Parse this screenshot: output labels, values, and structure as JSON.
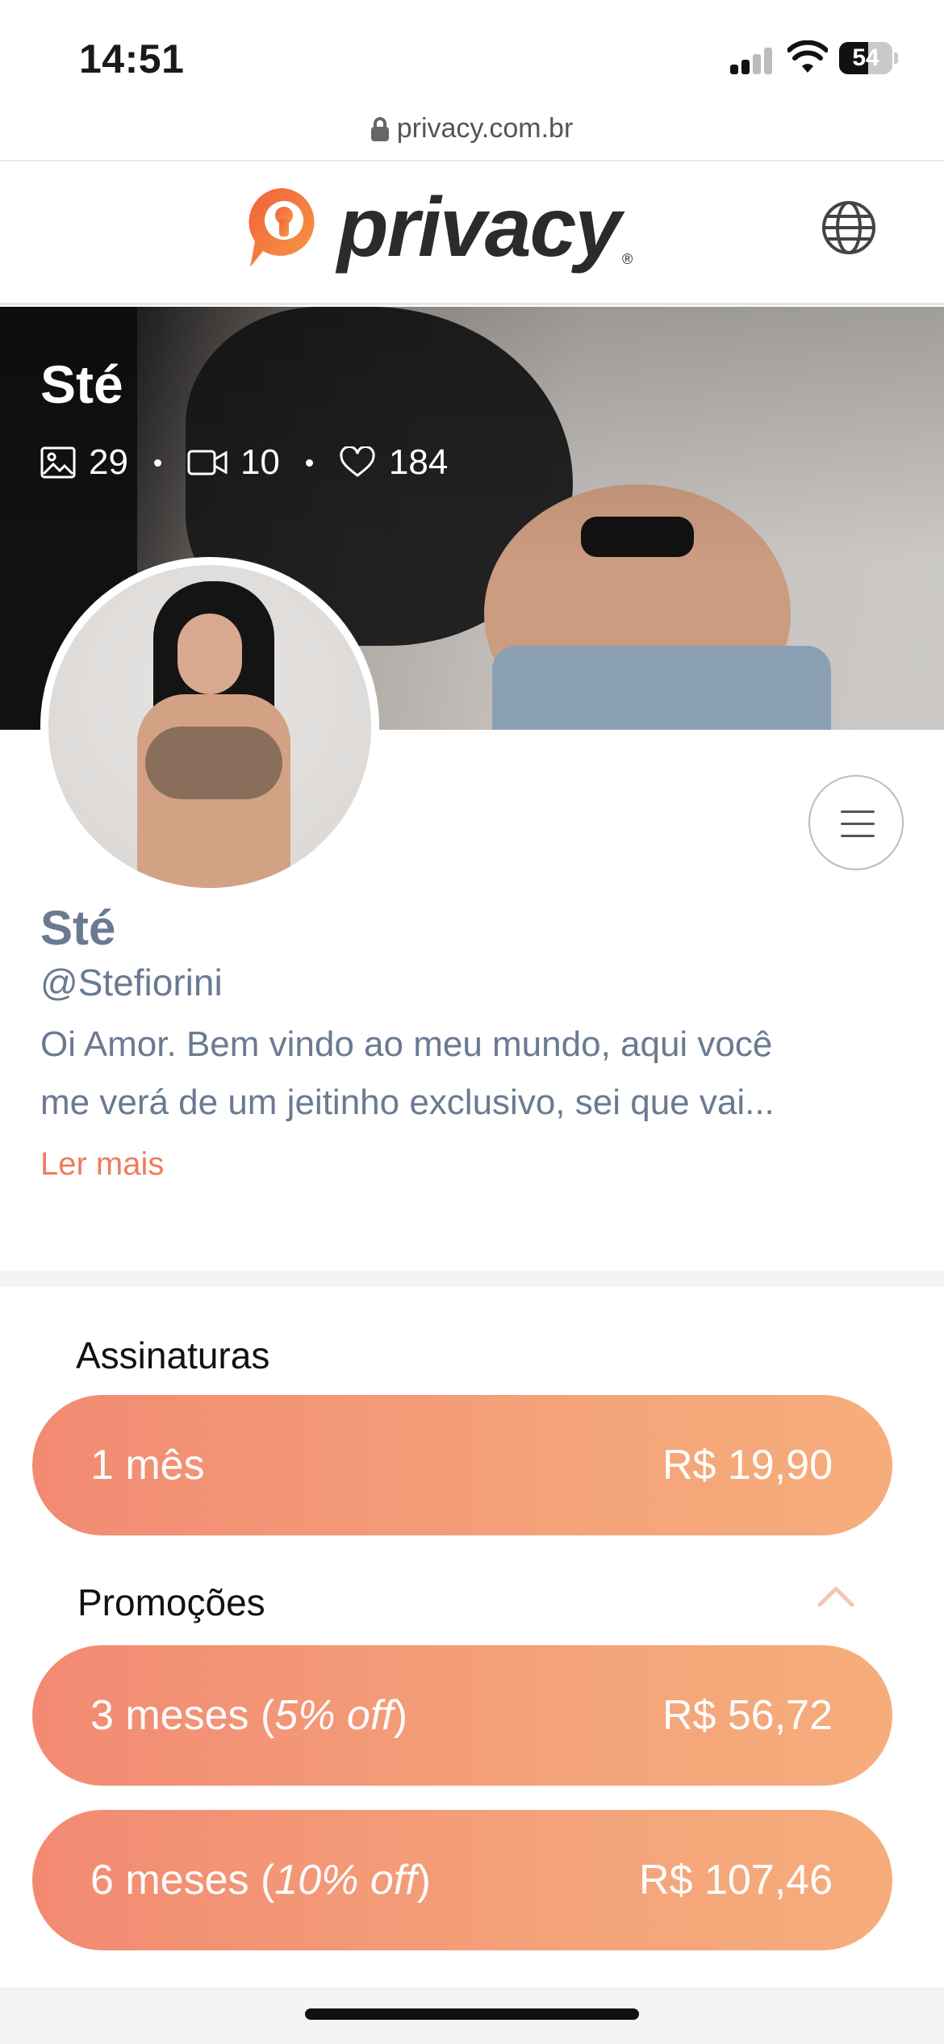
{
  "status_bar": {
    "time": "14:51",
    "battery": "54",
    "battery_level": 0.54
  },
  "browser": {
    "url": "privacy.com.br"
  },
  "header": {
    "brand": "privacy",
    "colors": {
      "brand_orange": "#f26b3a",
      "brand_dark": "#2b2b2b"
    }
  },
  "cover": {
    "name": "Sté",
    "stats": {
      "photos": "29",
      "videos": "10",
      "likes": "184"
    }
  },
  "profile": {
    "name": "Sté",
    "handle": "@Stefiorini",
    "bio_line1": "Oi Amor. Bem vindo ao meu mundo, aqui você",
    "bio_line2": "me verá de um jeitinho exclusivo, sei que vai...",
    "read_more": "Ler mais"
  },
  "subscriptions": {
    "title": "Assinaturas",
    "plans": [
      {
        "label": "1 mês",
        "price": "R$ 19,90"
      }
    ]
  },
  "promotions": {
    "title": "Promoções",
    "plans": [
      {
        "label_prefix": "3 meses (",
        "discount": "5% off",
        "label_suffix": ")",
        "price": "R$ 56,72"
      },
      {
        "label_prefix": "6 meses (",
        "discount": "10% off",
        "label_suffix": ")",
        "price": "R$ 107,46"
      }
    ]
  },
  "icons": [
    "lock-icon",
    "globe-icon",
    "image-icon",
    "video-icon",
    "heart-icon",
    "menu-icon",
    "chevron-up-icon"
  ],
  "accent_color": "#f07b5f"
}
